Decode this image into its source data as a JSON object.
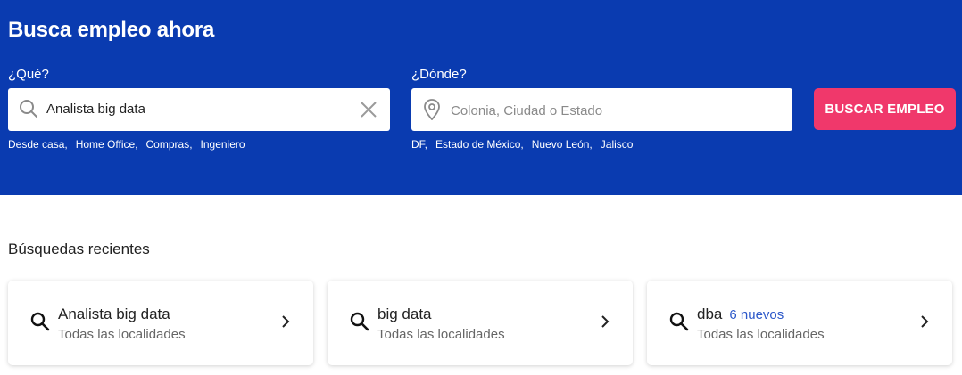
{
  "hero": {
    "title": "Busca empleo ahora",
    "what": {
      "label": "¿Qué?",
      "value": "Analista big data",
      "suggestions": [
        "Desde casa,",
        "Home Office,",
        "Compras,",
        "Ingeniero"
      ]
    },
    "where": {
      "label": "¿Dónde?",
      "placeholder": "Colonia, Ciudad o Estado",
      "suggestions": [
        "DF,",
        "Estado de México,",
        "Nuevo León,",
        "Jalisco"
      ]
    },
    "search_button": "BUSCAR EMPLEO"
  },
  "recent": {
    "title": "Búsquedas recientes",
    "items": [
      {
        "title": "Analista big data",
        "new_count": "",
        "location": "Todas las localidades"
      },
      {
        "title": "big data",
        "new_count": "",
        "location": "Todas las localidades"
      },
      {
        "title": "dba",
        "new_count": "6 nuevos",
        "location": "Todas las localidades"
      }
    ]
  },
  "colors": {
    "hero_bg": "#0a3bb0",
    "button": "#f0386b",
    "new_badge": "#2b57c9"
  },
  "icons": {
    "what_icon": "search-icon",
    "clear_icon": "close-icon",
    "where_icon": "location-pin-icon",
    "card_icon": "search-icon",
    "card_arrow": "chevron-right-icon"
  }
}
